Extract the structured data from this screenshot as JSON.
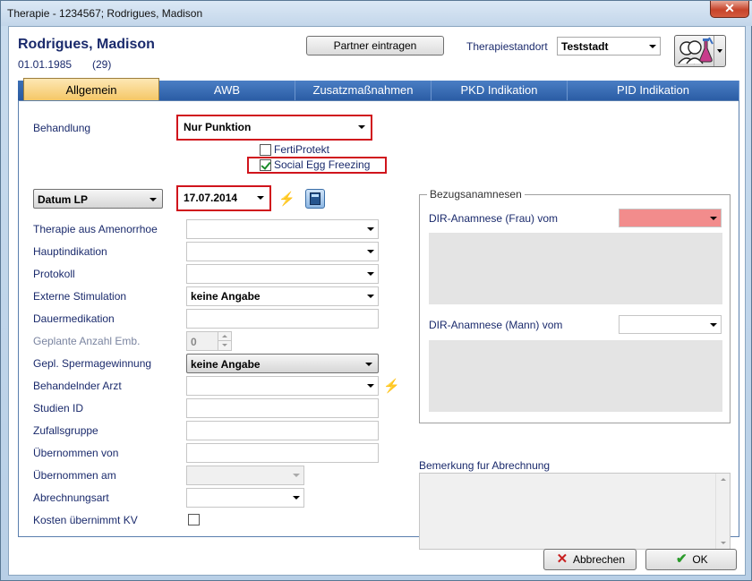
{
  "window": {
    "title": "Therapie - 1234567; Rodrigues, Madison",
    "close_glyph": "✕"
  },
  "patient": {
    "name": "Rodrigues, Madison",
    "dob": "01.01.1985",
    "age": "(29)"
  },
  "header": {
    "partner_button": "Partner eintragen",
    "standort_label": "Therapiestandort",
    "standort_value": "Teststadt"
  },
  "tabs": [
    "Allgemein",
    "AWB",
    "Zusatzmaßnahmen",
    "PKD Indikation",
    "PID Indikation"
  ],
  "form": {
    "behandlung_label": "Behandlung",
    "behandlung_value": "Nur Punktion",
    "fertiprotekt_label": "FertiProtekt",
    "fertiprotekt_checked": false,
    "social_egg_label": "Social Egg Freezing",
    "social_egg_checked": true,
    "datum_type": "Datum LP",
    "datum_value": "17.07.2014",
    "therapie_amenorrhoe_label": "Therapie aus Amenorrhoe",
    "hauptindikation_label": "Hauptindikation",
    "protokoll_label": "Protokoll",
    "externe_stimulation_label": "Externe Stimulation",
    "externe_stimulation_value": "keine Angabe",
    "dauermedikation_label": "Dauermedikation",
    "geplante_anzahl_label": "Geplante Anzahl Emb.",
    "geplante_anzahl_value": "0",
    "spermagewinnung_label": "Gepl. Spermagewinnung",
    "spermagewinnung_value": "keine Angabe",
    "behandelnder_arzt_label": "Behandelnder Arzt",
    "studien_id_label": "Studien ID",
    "zufallsgruppe_label": "Zufallsgruppe",
    "uebernommen_von_label": "Übernommen von",
    "uebernommen_am_label": "Übernommen am",
    "abrechnungsart_label": "Abrechnungsart",
    "kosten_kv_label": "Kosten übernimmt KV",
    "kosten_kv_checked": false
  },
  "bezugsanamnesen": {
    "title": "Bezugsanamnesen",
    "frau_label": "DIR-Anamnese (Frau) vom",
    "frau_color": "#f28c8c",
    "mann_label": "DIR-Anamnese (Mann) vom"
  },
  "bemerkung_label": "Bemerkung fur Abrechnung",
  "footer": {
    "cancel": "Abbrechen",
    "ok": "OK"
  },
  "colors": {
    "highlight": "#d0141c",
    "tab_active": "#f5c766",
    "label_text": "#1a2a6c"
  }
}
